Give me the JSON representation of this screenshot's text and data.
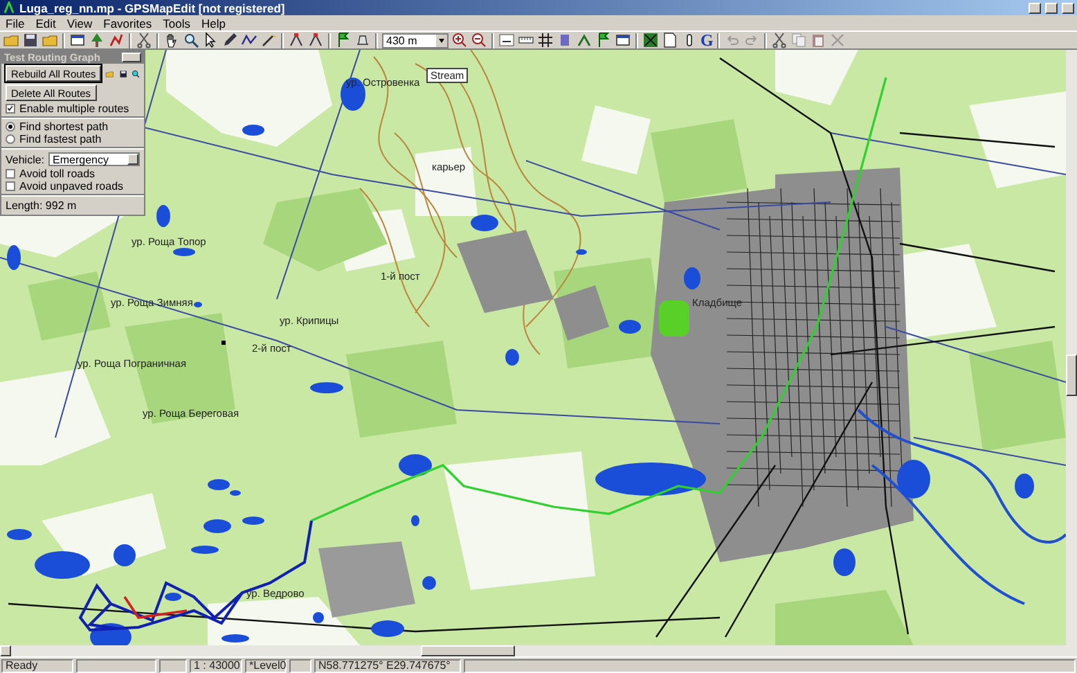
{
  "window": {
    "title": "Luga_reg_nn.mp - GPSMapEdit [not registered]"
  },
  "menu": [
    "File",
    "Edit",
    "View",
    "Favorites",
    "Tools",
    "Help"
  ],
  "toolbar": {
    "scale": "430 m",
    "g_button": "G"
  },
  "routing_panel": {
    "title": "Test Routing Graph",
    "buttons": [
      "Rebuild All Routes",
      "Delete All Routes"
    ],
    "multiple_routes": {
      "label": "Enable multiple routes",
      "checked": true
    },
    "modes": [
      {
        "label": "Find shortest path",
        "selected": true
      },
      {
        "label": "Find fastest path",
        "selected": false
      }
    ],
    "vehicle_label": "Vehicle:",
    "vehicle": "Emergency",
    "options": [
      {
        "label": "Avoid toll roads",
        "checked": false
      },
      {
        "label": "Avoid unpaved roads",
        "checked": false
      }
    ],
    "length": "Length: 992 m"
  },
  "map_labels": [
    {
      "text": "ур. Островенка",
      "kind": "place"
    },
    {
      "text": "Stream",
      "kind": "sign"
    },
    {
      "text": "карьер",
      "kind": "place"
    },
    {
      "text": "ур. Роща Топор",
      "kind": "place"
    },
    {
      "text": "ур. Роща Зимняя",
      "kind": "place"
    },
    {
      "text": "ур. Роща Пограничная",
      "kind": "place"
    },
    {
      "text": "ур. Роща Береговая",
      "kind": "place"
    },
    {
      "text": "ур. Крипицы",
      "kind": "place"
    },
    {
      "text": "2-й пост",
      "kind": "place"
    },
    {
      "text": "1-й пост",
      "kind": "place"
    },
    {
      "text": "ур. Ведрово",
      "kind": "place"
    },
    {
      "text": "Кладбище",
      "kind": "place"
    }
  ],
  "status_bar": {
    "message": "Ready",
    "scale": "1 : 43000",
    "level": "*Level0",
    "coordinates": "N58.771275° E29.747675°"
  }
}
